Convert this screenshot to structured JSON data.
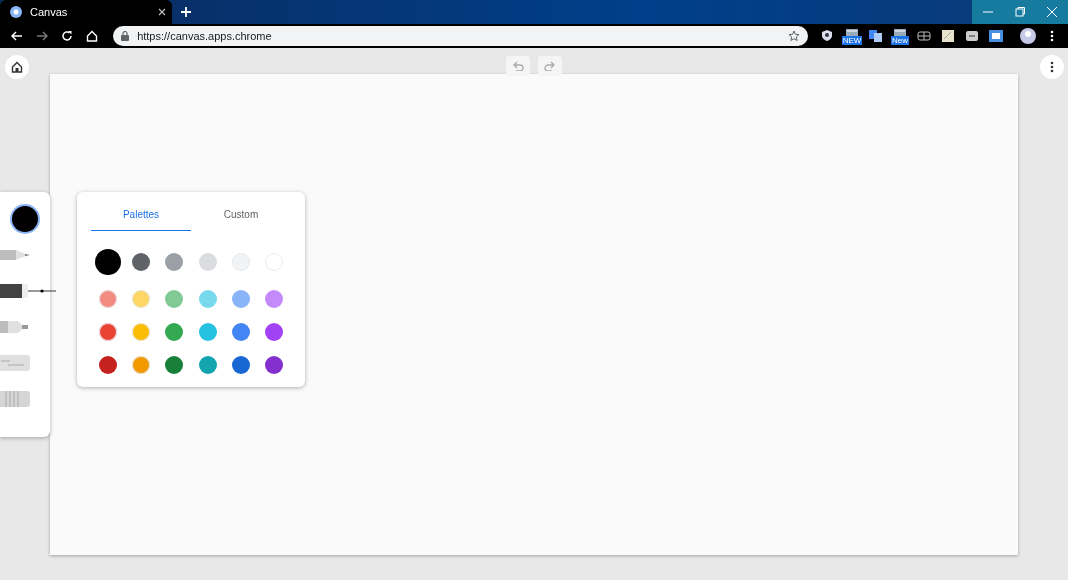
{
  "tab": {
    "title": "Canvas",
    "selected": true
  },
  "address_bar": {
    "url": "https://canvas.apps.chrome"
  },
  "extensions": [
    {
      "kind": "shield"
    },
    {
      "kind": "badge",
      "label": "NEW"
    },
    {
      "kind": "translate"
    },
    {
      "kind": "badge",
      "label": "New"
    },
    {
      "kind": "grid"
    },
    {
      "kind": "note"
    },
    {
      "kind": "chat"
    },
    {
      "kind": "screen"
    }
  ],
  "tools": [
    {
      "kind": "pencil",
      "selected": false
    },
    {
      "kind": "pen",
      "selected": true
    },
    {
      "kind": "marker",
      "selected": false
    },
    {
      "kind": "chalk",
      "selected": false
    },
    {
      "kind": "eraser",
      "selected": false
    }
  ],
  "current_color": {
    "color": "#000000"
  },
  "palette_tabs": [
    {
      "label": "Palettes",
      "selected": true
    },
    {
      "label": "Custom",
      "selected": false
    }
  ],
  "swatches": [
    {
      "color": "#000000",
      "selected": true
    },
    {
      "color": "#5f6368",
      "selected": false
    },
    {
      "color": "#9aa0a6",
      "selected": false
    },
    {
      "color": "#dadce0",
      "selected": false
    },
    {
      "color": "#f1f3f4",
      "selected": false
    },
    {
      "color": "#ffffff",
      "selected": false
    },
    {
      "color": "#f28b82",
      "selected": false
    },
    {
      "color": "#fdd663",
      "selected": false
    },
    {
      "color": "#81c995",
      "selected": false
    },
    {
      "color": "#78d9ec",
      "selected": false
    },
    {
      "color": "#8ab4f8",
      "selected": false
    },
    {
      "color": "#c58af9",
      "selected": false
    },
    {
      "color": "#ea4335",
      "selected": false
    },
    {
      "color": "#fbbc04",
      "selected": false
    },
    {
      "color": "#34a853",
      "selected": false
    },
    {
      "color": "#24c1e0",
      "selected": false
    },
    {
      "color": "#4285f4",
      "selected": false
    },
    {
      "color": "#a142f4",
      "selected": false
    },
    {
      "color": "#c5221f",
      "selected": false
    },
    {
      "color": "#f29900",
      "selected": false
    },
    {
      "color": "#188038",
      "selected": false
    },
    {
      "color": "#12a4af",
      "selected": false
    },
    {
      "color": "#1967d2",
      "selected": false
    },
    {
      "color": "#8430ce",
      "selected": false
    }
  ]
}
